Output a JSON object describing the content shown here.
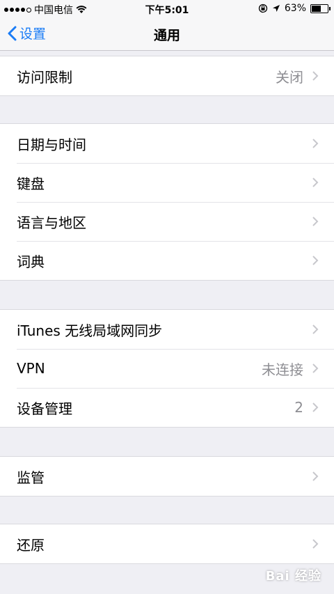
{
  "status_bar": {
    "carrier": "中国电信",
    "time": "下午5:01",
    "battery": "63%",
    "battery_level": 0.63
  },
  "nav": {
    "back_label": "设置",
    "title": "通用"
  },
  "groups": [
    {
      "rows": [
        {
          "label": "访问限制",
          "value": "关闭"
        }
      ]
    },
    {
      "rows": [
        {
          "label": "日期与时间",
          "value": ""
        },
        {
          "label": "键盘",
          "value": ""
        },
        {
          "label": "语言与地区",
          "value": ""
        },
        {
          "label": "词典",
          "value": ""
        }
      ]
    },
    {
      "rows": [
        {
          "label": "iTunes 无线局域网同步",
          "value": ""
        },
        {
          "label": "VPN",
          "value": "未连接"
        },
        {
          "label": "设备管理",
          "value": "2"
        }
      ]
    },
    {
      "rows": [
        {
          "label": "监管",
          "value": ""
        }
      ]
    },
    {
      "rows": [
        {
          "label": "还原",
          "value": ""
        }
      ]
    }
  ],
  "watermark": "Bai 经验"
}
